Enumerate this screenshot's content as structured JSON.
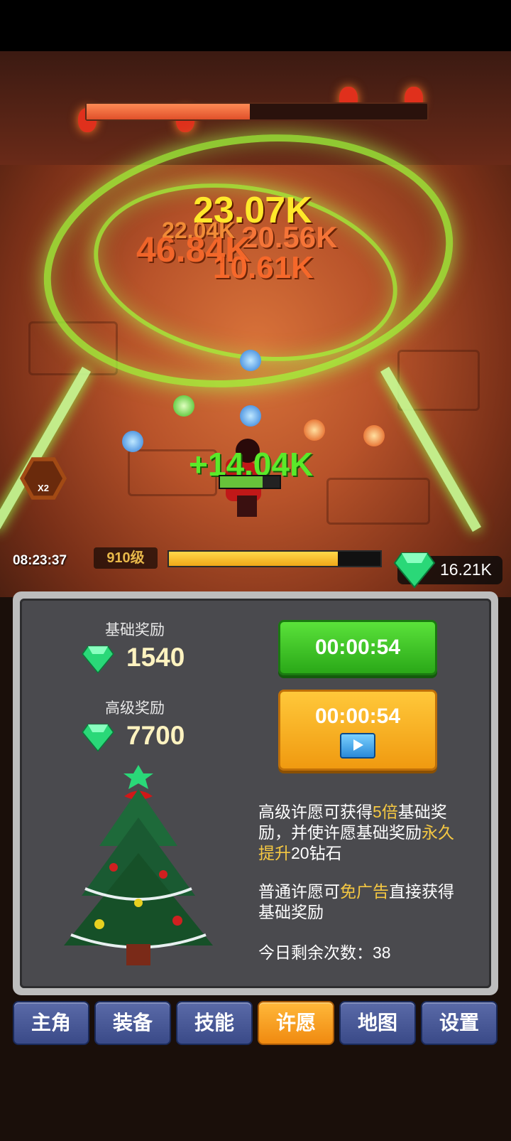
{
  "hud": {
    "buff_multiplier": "X2",
    "buff_timer": "08:23:37",
    "level": "910级",
    "xp_progress": 0.8,
    "boss_hp_progress": 0.48,
    "hero_hp_progress": 0.72,
    "gems": "16.21K"
  },
  "damage_numbers": {
    "d1": "23.07K",
    "d2": "46.84K",
    "d3": "20.56K",
    "d4": "10.61K",
    "d5": "22.04K",
    "heal": "+14.04K"
  },
  "wish": {
    "basic_label": "基础奖励",
    "basic_value": "1540",
    "advanced_label": "高级奖励",
    "advanced_value": "7700",
    "basic_timer": "00:00:54",
    "advanced_timer": "00:00:54",
    "desc1_a": "高级许愿可获得",
    "desc1_hl1": "5倍",
    "desc1_b": "基础奖励，并使许愿基础奖励",
    "desc1_hl2": "永久提升",
    "desc1_c": "20钻石",
    "desc2_a": "普通许愿可",
    "desc2_hl": "免广告",
    "desc2_b": "直接获得基础奖励",
    "remaining": "今日剩余次数：38"
  },
  "nav": {
    "hero": "主角",
    "equip": "装备",
    "skills": "技能",
    "wish": "许愿",
    "map": "地图",
    "settings": "设置"
  },
  "colors": {
    "accent_green": "#2aa818",
    "accent_orange": "#f09a10",
    "highlight_text": "#f5c842"
  }
}
